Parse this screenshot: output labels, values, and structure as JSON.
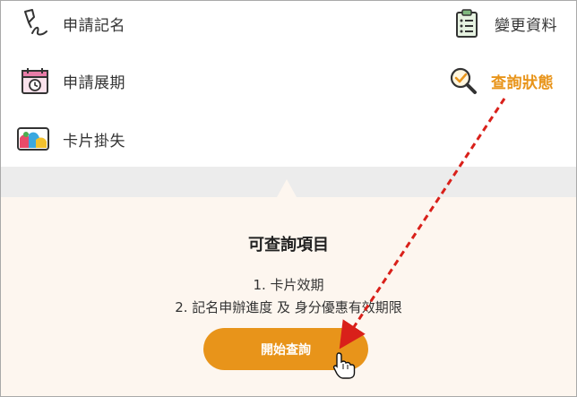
{
  "menu": {
    "items": [
      {
        "label": "申請記名",
        "icon": "pen-sign-icon"
      },
      {
        "label": "變更資料",
        "icon": "clipboard-list-icon"
      },
      {
        "label": "申請展期",
        "icon": "calendar-icon"
      },
      {
        "label": "查詢狀態",
        "icon": "magnifier-check-icon",
        "active": true
      },
      {
        "label": "卡片掛失",
        "icon": "card-picture-icon"
      }
    ]
  },
  "panel": {
    "title": "可查詢項目",
    "items": [
      "1. 卡片效期",
      "2. 記名申辦進度 及 身分優惠有效期限"
    ],
    "button_label": "開始查詢"
  },
  "colors": {
    "accent": "#e8941a",
    "annotation_arrow": "#d9201a"
  }
}
